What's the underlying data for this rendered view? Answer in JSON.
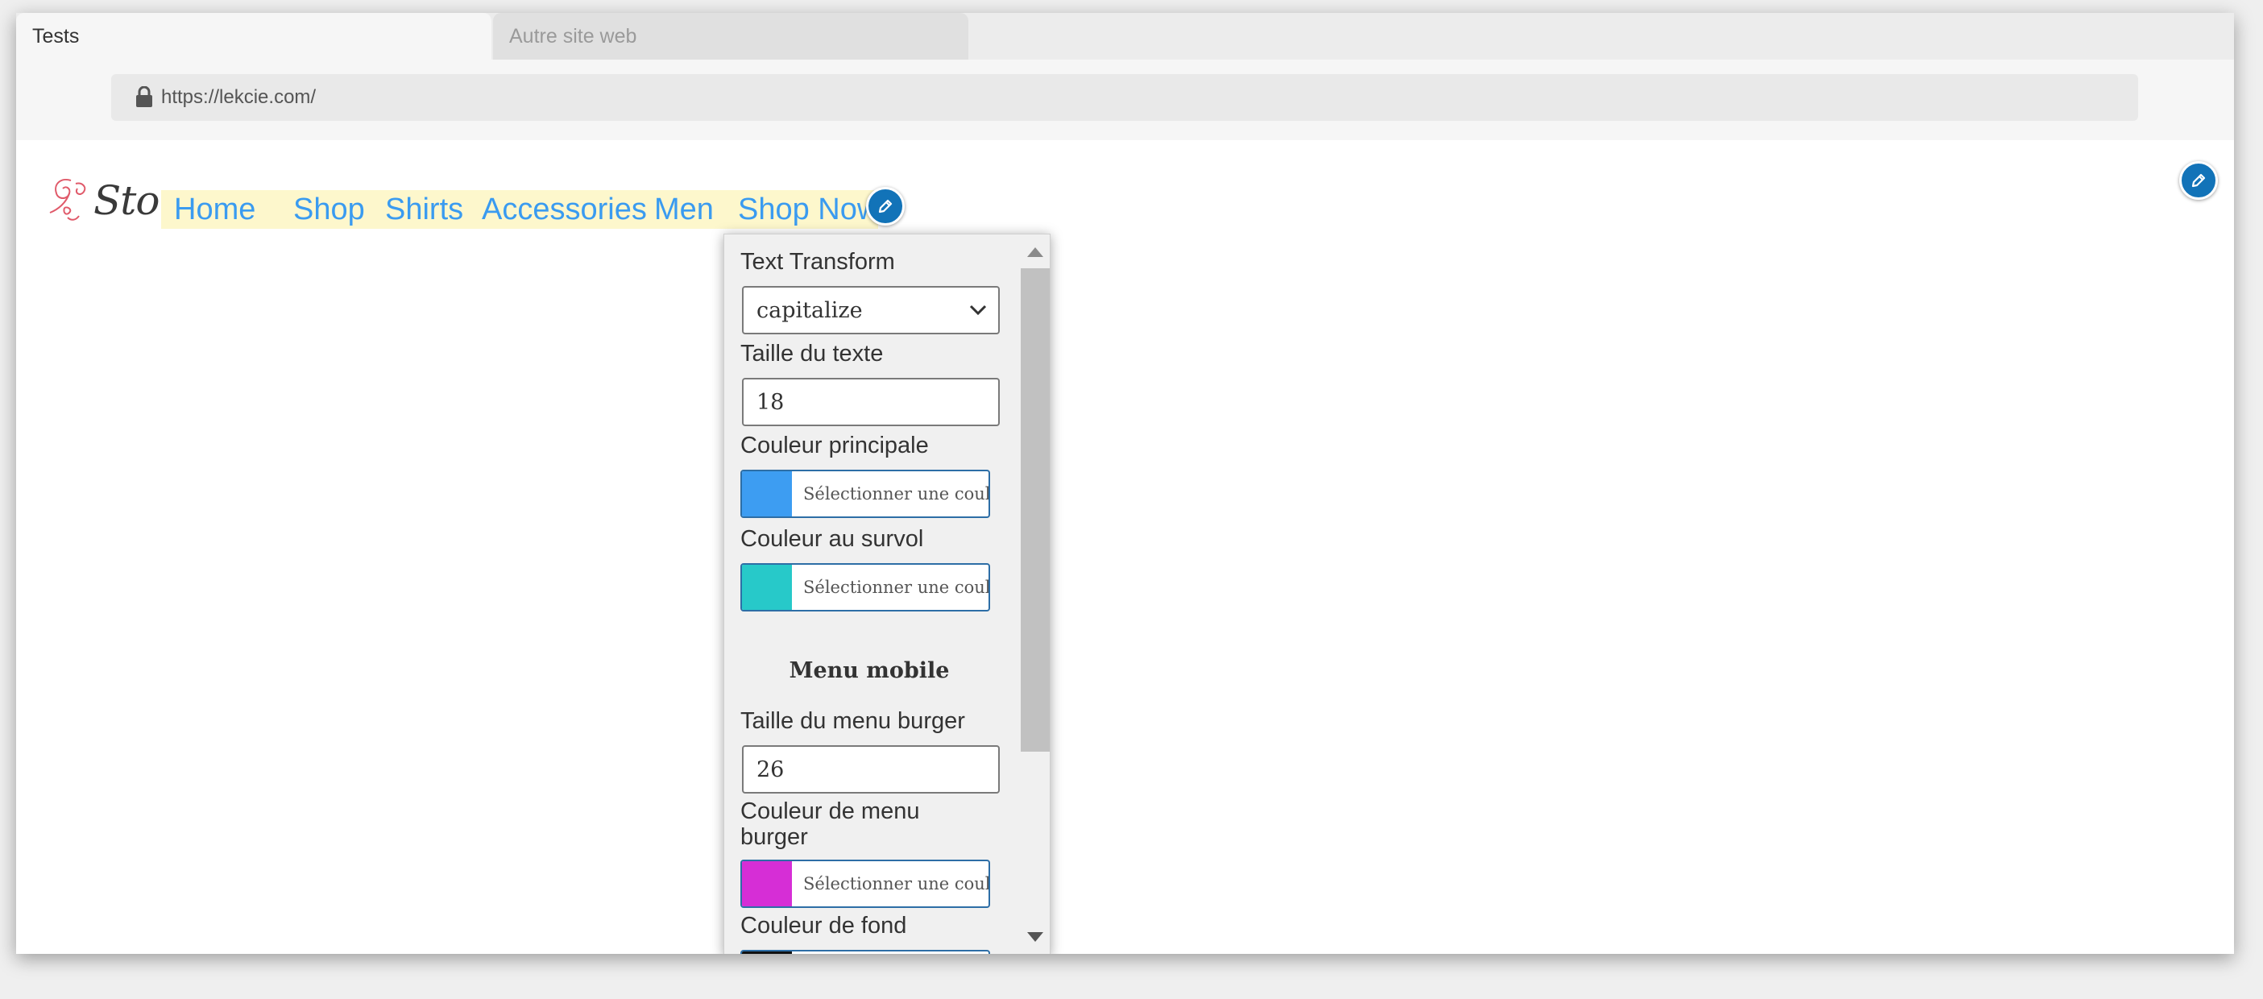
{
  "browser": {
    "tabs": [
      {
        "label": "Tests"
      },
      {
        "label": "Autre site web"
      }
    ],
    "url": "https://lekcie.com/"
  },
  "site": {
    "logo_text": "Store",
    "nav": [
      "Home",
      "Shop",
      "Shirts",
      "Accessories",
      "Men",
      "Shop Now"
    ]
  },
  "panel": {
    "text_transform": {
      "label": "Text Transform",
      "value": "capitalize"
    },
    "text_size": {
      "label": "Taille du texte",
      "value": "18"
    },
    "main_color": {
      "label": "Couleur principale",
      "button": "Sélectionner une couleur",
      "color": "#3d9df2"
    },
    "hover_color": {
      "label": "Couleur au survol",
      "button": "Sélectionner une couleur",
      "color": "#27c9c9"
    },
    "mobile_section": "Menu mobile",
    "burger_size": {
      "label": "Taille du menu burger",
      "value": "26"
    },
    "burger_color": {
      "label": "Couleur de menu burger",
      "button": "Sélectionner une couleur",
      "color": "#d62ed6"
    },
    "bg_color": {
      "label": "Couleur de fond",
      "color": "#111111"
    }
  },
  "colors": {
    "nav_link": "#3a9bf0",
    "nav_highlight": "#fdf7cc",
    "edit_button": "#1273b8"
  },
  "icons": {
    "lock": "lock-icon",
    "edit": "pencil-icon",
    "dropdown": "chevron-down-icon"
  }
}
